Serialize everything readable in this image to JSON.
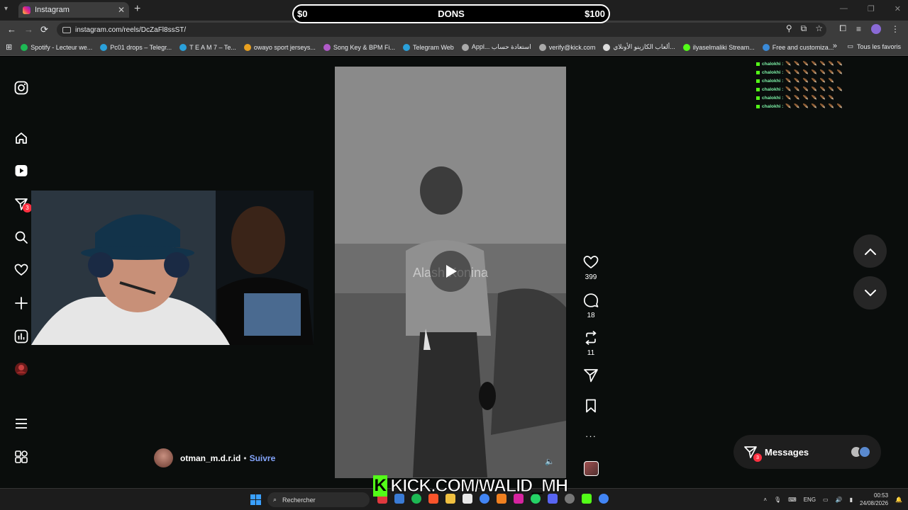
{
  "browser": {
    "tab_title": "Instagram",
    "tab_close": "✕",
    "new_tab": "+",
    "url": "instagram.com/reels/DcZaFl8ssST/",
    "back": "←",
    "forward": "→",
    "reload": "⟳"
  },
  "overlay": {
    "dons_left": "$0",
    "dons_title": "DONS",
    "dons_right": "$100",
    "kick_logo": "K",
    "kick_text": "KICK.COM/WALID_MH"
  },
  "bookmarks": [
    {
      "label": "Spotify - Lecteur we...",
      "color": "#1db954"
    },
    {
      "label": "Pc01 drops – Telegr...",
      "color": "#2aa0da"
    },
    {
      "label": "T E A M 7 – Te...",
      "color": "#2aa0da"
    },
    {
      "label": "owayo sport jerseys...",
      "color": "#e8a020"
    },
    {
      "label": "Song Key & BPM Fi...",
      "color": "#b05ac8"
    },
    {
      "label": "Telegram Web",
      "color": "#2aa0da"
    },
    {
      "label": "Appl... استعادة حساب",
      "color": "#aaaaaa"
    },
    {
      "label": "verify@kick.com",
      "color": "#aaaaaa"
    },
    {
      "label": "ألعاب الكازينو الأونلاي...",
      "color": "#dddddd"
    },
    {
      "label": "ilyaselmaliki Stream...",
      "color": "#53fc18"
    },
    {
      "label": "Free and customiza...",
      "color": "#3a8ad8"
    }
  ],
  "bookmarks_right": "Tous les favoris",
  "sidebar": {
    "notification_count": "3"
  },
  "reel": {
    "watermark": "Alash Konina",
    "likes": "399",
    "comments": "18",
    "reposts": "11",
    "more": "···"
  },
  "author": {
    "username": "otman_m.d.r.id",
    "separator": "•",
    "follow": "Suivre"
  },
  "chat": [
    {
      "user": "chalokhi :",
      "emotes": "🪶🪶🪶🪶🪶🪶🪶"
    },
    {
      "user": "chalokhi :",
      "emotes": "🪶🪶🪶🪶🪶🪶🪶"
    },
    {
      "user": "chalokhi :",
      "emotes": "🪶🪶🪶🪶🪶🪶"
    },
    {
      "user": "chalokhi :",
      "emotes": "🪶🪶🪶🪶🪶🪶🪶"
    },
    {
      "user": "chalokhi :",
      "emotes": "🪶🪶🪶🪶🪶🪶"
    },
    {
      "user": "chalokhi :",
      "emotes": "🪶🪶🪶🪶🪶🪶🪶"
    }
  ],
  "messages": {
    "label": "Messages",
    "badge": "3"
  },
  "taskbar": {
    "search_placeholder": "Rechercher",
    "lang": "ENG",
    "time": "00:53",
    "date": "24/08/2026"
  },
  "colors": {
    "accent_follow": "#85a6ff",
    "badge_red": "#ff3040",
    "kick_green": "#53fc18"
  }
}
